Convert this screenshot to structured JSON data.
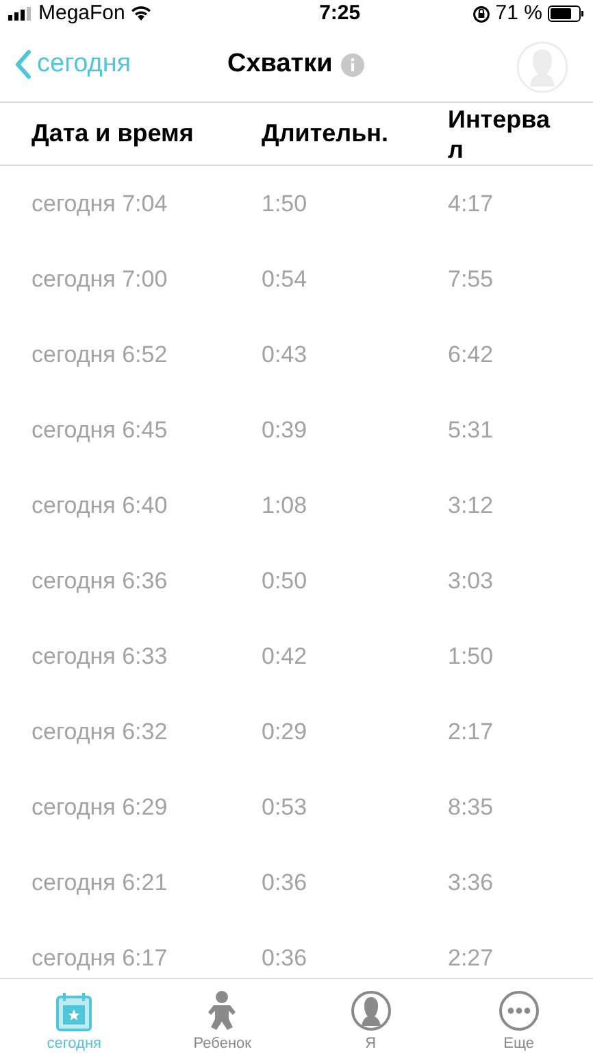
{
  "status_bar": {
    "carrier": "MegaFon",
    "time": "7:25",
    "battery": "71 %"
  },
  "nav": {
    "back": "сегодня",
    "title": "Схватки"
  },
  "table": {
    "columns": [
      "Дата и время",
      "Длительн.",
      "Интервал"
    ],
    "rows": [
      [
        "сегодня 7:04",
        "1:50",
        "4:17"
      ],
      [
        "сегодня 7:00",
        "0:54",
        "7:55"
      ],
      [
        "сегодня 6:52",
        "0:43",
        "6:42"
      ],
      [
        "сегодня 6:45",
        "0:39",
        "5:31"
      ],
      [
        "сегодня 6:40",
        "1:08",
        "3:12"
      ],
      [
        "сегодня 6:36",
        "0:50",
        "3:03"
      ],
      [
        "сегодня 6:33",
        "0:42",
        "1:50"
      ],
      [
        "сегодня 6:32",
        "0:29",
        "2:17"
      ],
      [
        "сегодня 6:29",
        "0:53",
        "8:35"
      ],
      [
        "сегодня 6:21",
        "0:36",
        "3:36"
      ],
      [
        "сегодня 6:17",
        "0:36",
        "2:27"
      ]
    ]
  },
  "tabs": [
    {
      "label": "сегодня",
      "kind": "calendar",
      "selected": true
    },
    {
      "label": "Ребенок",
      "kind": "baby",
      "selected": false
    },
    {
      "label": "Я",
      "kind": "person",
      "selected": false
    },
    {
      "label": "Еще",
      "kind": "more",
      "selected": false
    }
  ]
}
